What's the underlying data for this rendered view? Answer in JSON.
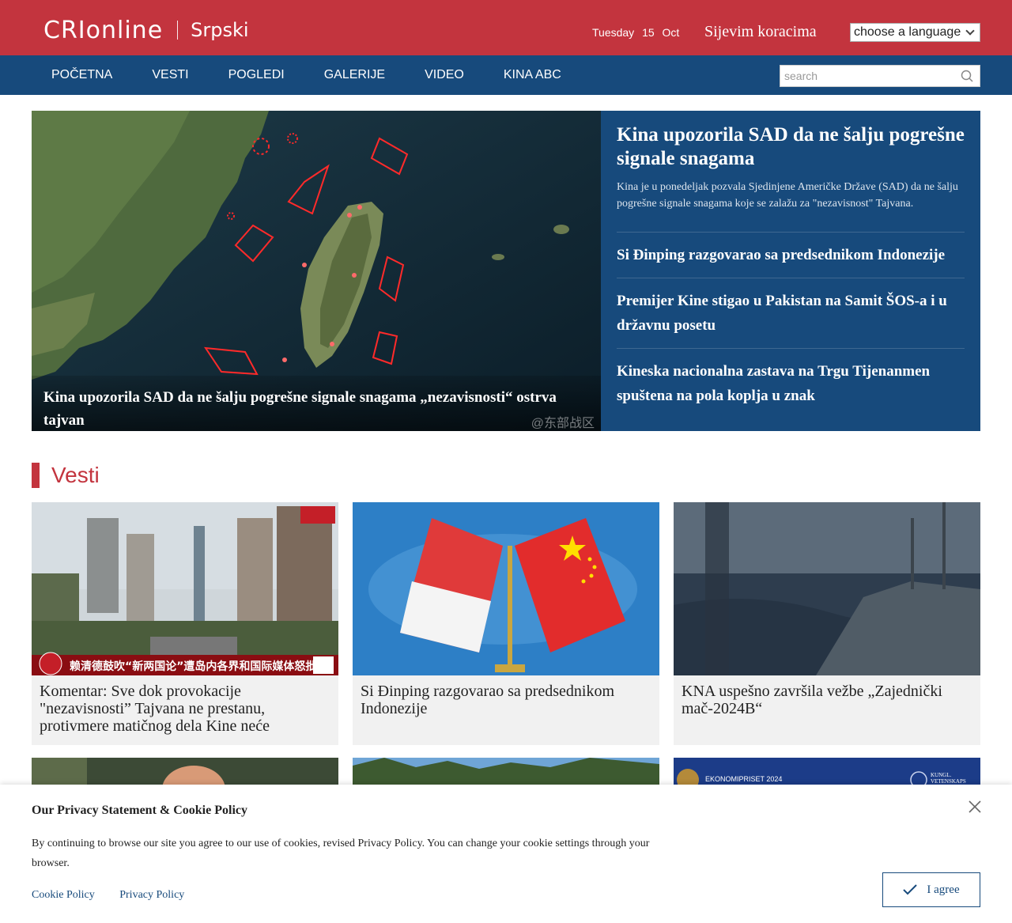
{
  "header": {
    "logo_text": "CRIonline",
    "logo_language": "Srpski",
    "date_day": "Tuesday",
    "date_num": "15",
    "date_month": "Oct",
    "slogan": "Sijevim koracima",
    "language_select": "choose a language"
  },
  "nav": {
    "items": [
      "POČETNA",
      "VESTI",
      "POGLEDI",
      "GALERIJE",
      "VIDEO",
      "KINA ABC"
    ],
    "search_placeholder": "search"
  },
  "hero": {
    "caption": "Kina upozorila SAD da ne šalju pogrešne signale snagama „nezavisnosti“ ostrva tajvan",
    "watermark": "@东部战区",
    "headline": "Kina upozorila SAD da ne šalju pogrešne signale snagama",
    "lead": "Kina je u ponedeljak pozvala Sjedinjene Američke Države (SAD) da ne šalju pogrešne signale snagama koje se zalažu za \"nezavisnost\" Tajvana.",
    "side_items": [
      "Si Đinping razgovarao sa predsednikom Indonezije",
      "Premijer Kine stigao u Pakistan na Samit ŠOS-a i u državnu posetu",
      "Kineska nacionalna zastava na Trgu Tijenanmen spuštena na pola koplja u znak"
    ]
  },
  "section": {
    "title": "Vesti"
  },
  "cards": [
    {
      "title": "Komentar: Sve dok provokacije \"nezavisnosti” Tajvana ne prestanu, protivmere matičnog dela Kine neće",
      "overlay": "赖清德鼓吹“新两国论”遭岛内各界和国际媒体怒批"
    },
    {
      "title": "Si Đinping razgovarao sa predsednikom Indonezije"
    },
    {
      "title": "KNA uspešno završila vežbe „Zajednički mač-2024B“"
    }
  ],
  "cards_row2": [
    {
      "label": ""
    },
    {
      "label": ""
    },
    {
      "label": "EKONOMIPRISET 2024",
      "label2": "KUNGL. VETENSKAPS"
    }
  ],
  "cookie": {
    "title": "Our Privacy Statement & Cookie Policy",
    "text": "By continuing to browse our site you agree to our use of cookies, revised Privacy Policy. You can change your cookie settings through your browser.",
    "link1": "Cookie Policy",
    "link2": "Privacy Policy",
    "agree": "I agree"
  },
  "colors": {
    "brand_red": "#c3343e",
    "brand_blue": "#174a7c"
  }
}
